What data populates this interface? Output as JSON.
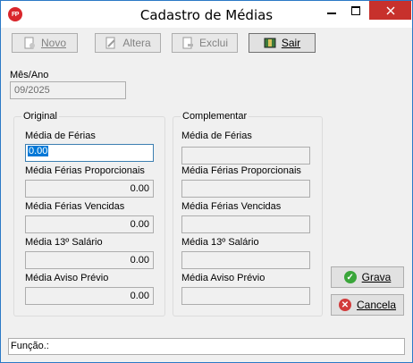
{
  "window": {
    "title": "Cadastro de Médias",
    "app_icon_text": "FP"
  },
  "toolbar": {
    "novo": {
      "label": "Novo",
      "icon": "new-doc-icon"
    },
    "altera": {
      "label": "Altera",
      "icon": "edit-doc-icon"
    },
    "exclui": {
      "label": "Exclui",
      "icon": "delete-doc-icon"
    },
    "sair": {
      "label": "Sair",
      "icon": "exit-icon"
    }
  },
  "mes_ano": {
    "label": "Mês/Ano",
    "value": "09/2025"
  },
  "original": {
    "title": "Original",
    "fields": [
      {
        "label": "Média de Férias",
        "value": "0.00"
      },
      {
        "label": "Média Férias Proporcionais",
        "value": "0.00"
      },
      {
        "label": "Média Férias Vencidas",
        "value": "0.00"
      },
      {
        "label": "Média 13º Salário",
        "value": "0.00"
      },
      {
        "label": "Média Aviso Prévio",
        "value": "0.00"
      }
    ]
  },
  "complementar": {
    "title": "Complementar",
    "fields": [
      {
        "label": "Média de Férias",
        "value": ""
      },
      {
        "label": "Média Férias Proporcionais",
        "value": ""
      },
      {
        "label": "Média Férias Vencidas",
        "value": ""
      },
      {
        "label": "Média 13º Salário",
        "value": ""
      },
      {
        "label": "Média Aviso Prévio",
        "value": ""
      }
    ]
  },
  "actions": {
    "grava": {
      "label": "Grava",
      "icon": "check-icon",
      "color": "#3aa63a"
    },
    "cancela": {
      "label": "Cancela",
      "icon": "cancel-icon",
      "color": "#d23b3b"
    }
  },
  "funcao": {
    "label": "Função.:",
    "value": ""
  }
}
